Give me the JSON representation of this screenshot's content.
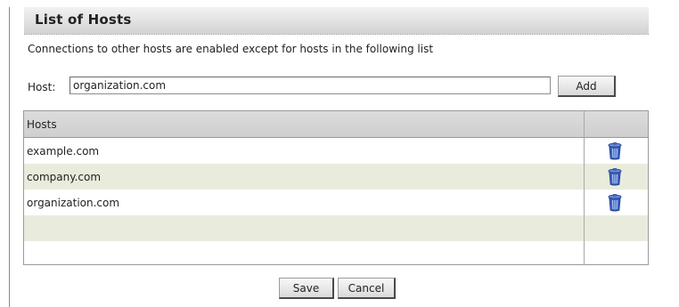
{
  "panel": {
    "title": "List of Hosts",
    "description": "Connections to other hosts are enabled except for hosts in the following list"
  },
  "host_form": {
    "label": "Host:",
    "value": "organization.com",
    "add_label": "Add"
  },
  "table": {
    "column_header": "Hosts",
    "rows": [
      {
        "host": "example.com",
        "action_icon": "trash-icon"
      },
      {
        "host": "company.com",
        "action_icon": "trash-icon"
      },
      {
        "host": "organization.com",
        "action_icon": "trash-icon"
      },
      {
        "host": ""
      },
      {
        "host": ""
      }
    ]
  },
  "footer": {
    "save_label": "Save",
    "cancel_label": "Cancel"
  },
  "colors": {
    "alt_row": "#e9ecdc",
    "trash_icon": "#3b63c4"
  }
}
